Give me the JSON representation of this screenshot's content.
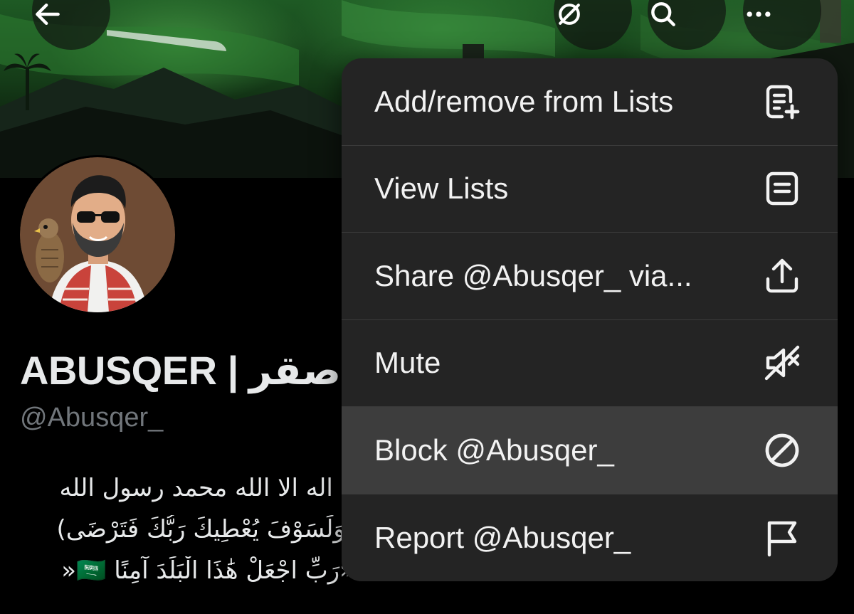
{
  "header": {
    "back_icon": "arrow-left-icon",
    "grok_icon": "grok-icon",
    "search_icon": "search-icon",
    "more_icon": "more-horizontal-icon"
  },
  "profile": {
    "display_name": "ABUSQER | صقر",
    "handle": "@Abusqer_",
    "bio_lines": [
      "لا اله الا الله محمد رسول الله",
      "(وَلَسَوْفَ يُعْطِيكَ رَبُّكَ فَتَرْضَى)",
      "«رَبِّ اجْعَلْ هَٰذَا الْبَلَدَ آمِنًا 🇸🇦«"
    ]
  },
  "menu": {
    "items": [
      {
        "label": "Add/remove from Lists",
        "icon": "list-add-icon"
      },
      {
        "label": "View Lists",
        "icon": "list-icon"
      },
      {
        "label": "Share @Abusqer_ via...",
        "icon": "share-icon"
      },
      {
        "label": "Mute",
        "icon": "speaker-muted-icon"
      },
      {
        "label": "Block @Abusqer_",
        "icon": "block-icon",
        "highlighted": true
      },
      {
        "label": "Report @Abusqer_",
        "icon": "flag-icon"
      }
    ]
  },
  "colors": {
    "background": "#000000",
    "menu_background": "#242424",
    "menu_highlight": "#3d3d3d",
    "text_primary": "#e7e9ea",
    "text_secondary": "#71767b",
    "flag_green": "#1f7a2e"
  }
}
